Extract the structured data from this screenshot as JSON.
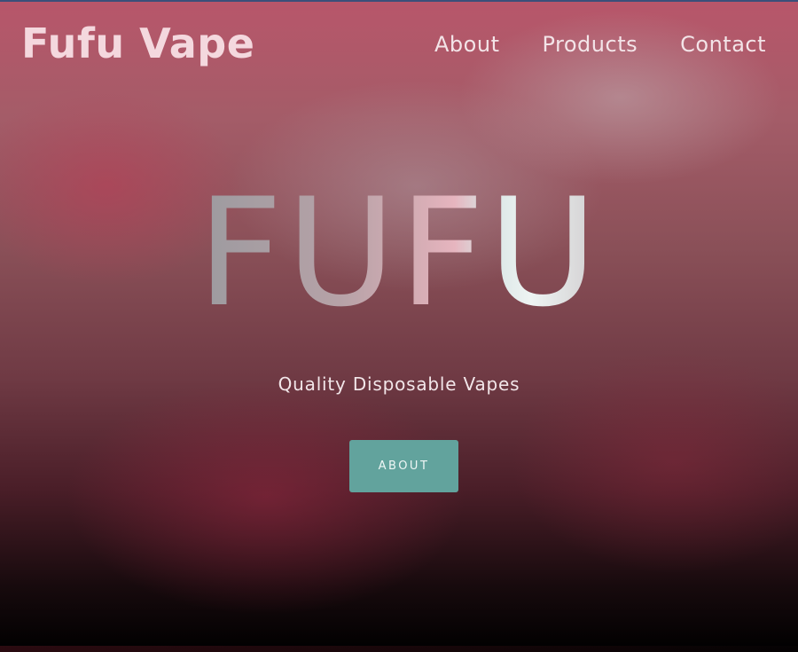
{
  "header": {
    "brand": "Fufu Vape",
    "nav": [
      {
        "label": "About"
      },
      {
        "label": "Products"
      },
      {
        "label": "Contact"
      }
    ]
  },
  "hero": {
    "title": "FUFU",
    "subtitle": "Quality Disposable Vapes",
    "button_label": "ABOUT"
  },
  "colors": {
    "accent_button": "#62a39d",
    "brand_text": "#f4d8de",
    "background_top": "#b8566a",
    "background_bottom": "#000000"
  }
}
